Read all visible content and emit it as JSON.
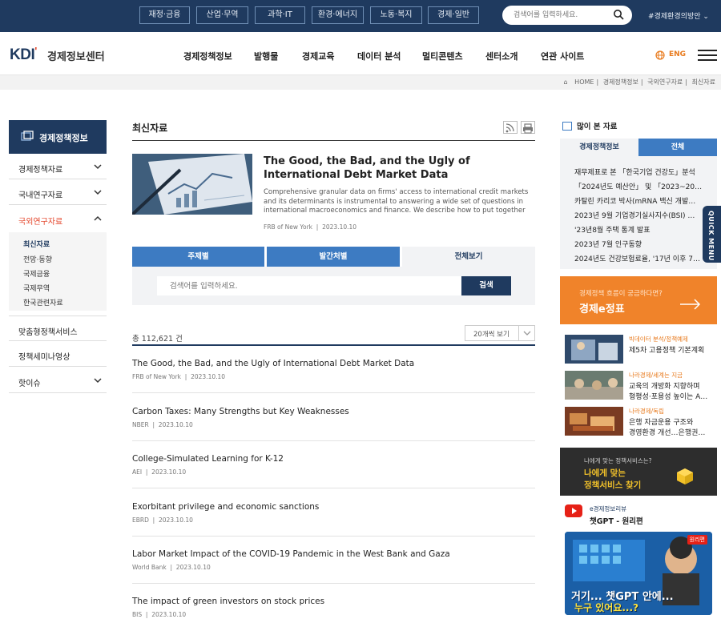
{
  "top_bar": {
    "categories": [
      "재정·금융",
      "산업·무역",
      "과학·IT",
      "환경·에너지",
      "노동·복지",
      "경제·일반"
    ],
    "search_placeholder": "검색어를 입력하세요.",
    "hashtag": "#경제환경의방안"
  },
  "header": {
    "logo_mark": "KDI",
    "logo_text": "경제정보센터",
    "menu": [
      "경제정책정보",
      "발행물",
      "경제교육",
      "데이터 분석",
      "멀티콘텐츠",
      "센터소개",
      "연관 사이트"
    ],
    "language": "ENG"
  },
  "breadcrumb": [
    "HOME",
    "경제정책정보",
    "국외연구자료",
    "최신자료"
  ],
  "sidebar": {
    "title": "경제정책정보",
    "items": [
      "경제정책자료",
      "국내연구자료",
      "국외연구자료",
      "맞춤형정책서비스",
      "정책세미나영상",
      "핫이슈"
    ],
    "sub_items": [
      "최신자료",
      "전망·동향",
      "국제금융",
      "국제무역",
      "한국관련자료"
    ]
  },
  "main": {
    "section_title": "최신자료",
    "featured": {
      "title": "The Good, the Bad, and the Ugly of International Debt Market Data",
      "description": "Comprehensive granular data on firms' access to international credit markets and its determinants is instrumental to answering a wide set of questions in international macroeconomics and finance. We describe how to put together dat…",
      "source": "FRB of New York",
      "date": "2023.10.10"
    },
    "tabs": [
      "주제별",
      "발간처별",
      "전체보기"
    ],
    "search_placeholder": "검색어를 입력하세요.",
    "search_button": "검색",
    "total": "총 112,621 건",
    "per_page": "20개씩 보기",
    "list": [
      {
        "title": "The Good, the Bad, and the Ugly of International Debt Market Data",
        "source": "FRB of New York",
        "date": "2023.10.10"
      },
      {
        "title": "Carbon Taxes: Many Strengths but Key Weaknesses",
        "source": "NBER",
        "date": "2023.10.10"
      },
      {
        "title": "College-Simulated Learning for K-12",
        "source": "AEI",
        "date": "2023.10.10"
      },
      {
        "title": "Exorbitant privilege and economic sanctions",
        "source": "EBRD",
        "date": "2023.10.10"
      },
      {
        "title": "Labor Market Impact of the COVID-19 Pandemic in the West Bank and Gaza",
        "source": "World Bank",
        "date": "2023.10.10"
      },
      {
        "title": "The impact of green investors on stock prices",
        "source": "BIS",
        "date": "2023.10.10"
      }
    ]
  },
  "right": {
    "popular_title": "많이 본 자료",
    "popular_tabs": [
      "경제정책정보",
      "전체"
    ],
    "popular_list": [
      "재무제표로 본 「한국기업 건강도」분석",
      "「2024년도 예산안」 및 「2023~2027 …",
      "카탈린 카리코 박사(mRNA 백신 개발…",
      "2023년 9월 기업경기실사지수(BSI) …",
      "'23년8월 주택 통계 발표",
      "2023년 7월 인구동향",
      "2024년도 건강보험료율, '17년 이후 7…"
    ],
    "quick_menu": "QUICK MENU",
    "banner_small": "경제정책 흐름이 궁금하다면?",
    "banner_big": "경제e정표",
    "news": [
      {
        "category": "빅데이터 분석/정책예제",
        "line1": "제5차 고용정책 기본계획",
        "line2": ""
      },
      {
        "category": "나라경제/세계는 지금",
        "line1": "교육의 개방화 지향하며",
        "line2": "형평성·포용성 높이는 A…"
      },
      {
        "category": "나라경제/독립",
        "line1": "은행 자금운용 구조와",
        "line2": "경영환경 개선…은행권…"
      }
    ],
    "service_small": "나에게 맞는 정책서비스는?",
    "service_line1": "나에게 맞는",
    "service_line2": "정책서비스 찾기",
    "video_channel": "e경제정보리뷰",
    "video_title": "챗GPT - 원리편",
    "video_caption1": "거기... 챗GPT 안에...",
    "video_caption2": "누구 있어요...?",
    "video_tag": "원리편"
  },
  "colors": {
    "navy": "#1f3a5f",
    "blue": "#3d7bc2",
    "orange": "#f0832a",
    "red": "#e4462c"
  }
}
